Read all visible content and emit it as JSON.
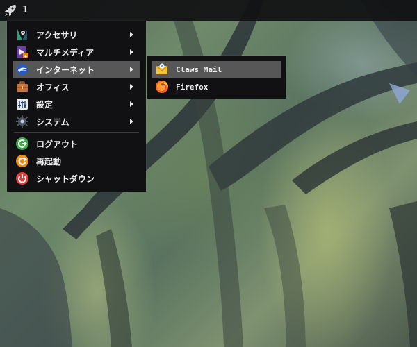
{
  "panel": {
    "launcher_icon": "rocket-icon",
    "workspace_number": "1"
  },
  "main_menu": {
    "items": [
      {
        "label": "アクセサリ",
        "icon": "accessories-icon",
        "has_submenu": true
      },
      {
        "label": "マルチメディア",
        "icon": "multimedia-icon",
        "has_submenu": true
      },
      {
        "label": "インターネット",
        "icon": "internet-icon",
        "has_submenu": true,
        "highlighted": true
      },
      {
        "label": "オフィス",
        "icon": "office-icon",
        "has_submenu": true
      },
      {
        "label": "設定",
        "icon": "settings-icon",
        "has_submenu": true
      },
      {
        "label": "システム",
        "icon": "system-icon",
        "has_submenu": true
      },
      {
        "label": "ログアウト",
        "icon": "logout-icon",
        "has_submenu": false
      },
      {
        "label": "再起動",
        "icon": "restart-icon",
        "has_submenu": false
      },
      {
        "label": "シャットダウン",
        "icon": "shutdown-icon",
        "has_submenu": false
      }
    ]
  },
  "internet_submenu": {
    "items": [
      {
        "label": "Claws Mail",
        "icon": "claws-mail-icon",
        "highlighted": true
      },
      {
        "label": "Firefox",
        "icon": "firefox-icon"
      }
    ]
  },
  "colors": {
    "menu_background": "#111113",
    "highlight": "#575757",
    "panel_background": "#101012",
    "text": "#ececec"
  }
}
